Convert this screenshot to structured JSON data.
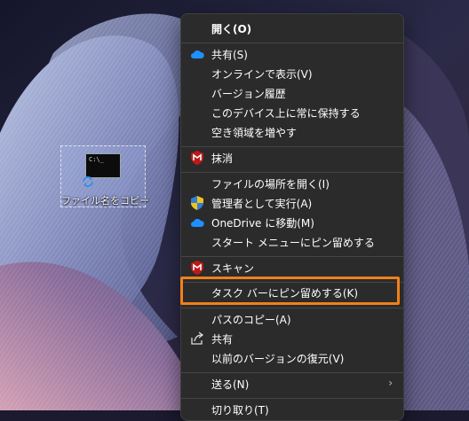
{
  "desktop": {
    "icon_label": "ファイル名をコピー",
    "thumb_text": "C:\\_"
  },
  "menu": {
    "items": [
      {
        "label": "開く(O)",
        "icon": ""
      },
      {
        "label": "共有(S)",
        "icon": "onedrive-cloud-icon"
      },
      {
        "label": "オンラインで表示(V)",
        "icon": ""
      },
      {
        "label": "バージョン履歴",
        "icon": ""
      },
      {
        "label": "このデバイス上に常に保持する",
        "icon": ""
      },
      {
        "label": "空き領域を増やす",
        "icon": ""
      },
      {
        "label": "抹消",
        "icon": "mcafee-shield-icon"
      },
      {
        "label": "ファイルの場所を開く(I)",
        "icon": ""
      },
      {
        "label": "管理者として実行(A)",
        "icon": "uac-shield-icon"
      },
      {
        "label": "OneDrive に移動(M)",
        "icon": "onedrive-cloud-icon"
      },
      {
        "label": "スタート メニューにピン留めする",
        "icon": ""
      },
      {
        "label": "スキャン",
        "icon": "mcafee-shield-icon"
      },
      {
        "label": "タスク バーにピン留めする(K)",
        "icon": ""
      },
      {
        "label": "パスのコピー(A)",
        "icon": ""
      },
      {
        "label": "共有",
        "icon": "share-icon"
      },
      {
        "label": "以前のバージョンの復元(V)",
        "icon": ""
      },
      {
        "label": "送る(N)",
        "icon": "",
        "submenu": true
      },
      {
        "label": "切り取り(T)",
        "icon": ""
      }
    ],
    "submenu_glyph": "›"
  },
  "colors": {
    "menu_bg": "#2b2b2b",
    "highlight": "#f0801c",
    "onedrive": "#1e90ff",
    "mcafee": "#c01818"
  }
}
